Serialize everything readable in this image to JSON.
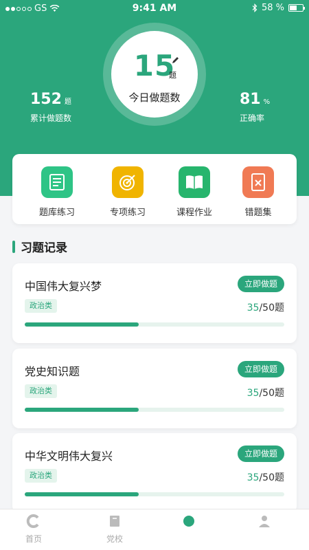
{
  "status_bar": {
    "carrier": "GS",
    "time": "9:41 AM",
    "battery_percent": "58 %",
    "battery_level": 0.58
  },
  "today": {
    "count": "15",
    "unit": "题",
    "label": "今日做题数"
  },
  "stats": {
    "total": {
      "value": "152",
      "unit": "题",
      "label": "累计做题数"
    },
    "accuracy": {
      "value": "81",
      "unit": "%",
      "label": "正确率"
    }
  },
  "quick_actions": [
    {
      "label": "题库练习",
      "icon": "question-bank-icon",
      "color": "#2ec486"
    },
    {
      "label": "专项练习",
      "icon": "target-icon",
      "color": "#f0b400"
    },
    {
      "label": "课程作业",
      "icon": "book-icon",
      "color": "#27b56d"
    },
    {
      "label": "错题集",
      "icon": "wrong-notebook-icon",
      "color": "#f07a54"
    }
  ],
  "section": {
    "title": "习题记录"
  },
  "records": [
    {
      "title": "中国伟大复兴梦",
      "tag": "政治类",
      "done": "35",
      "total": "/50题",
      "progress": 0.44,
      "button": "立即做题"
    },
    {
      "title": "党史知识题",
      "tag": "政治类",
      "done": "35",
      "total": "/50题",
      "progress": 0.44,
      "button": "立即做题"
    },
    {
      "title": "中华文明伟大复兴",
      "tag": "政治类",
      "done": "35",
      "total": "/50题",
      "progress": 0.44,
      "button": "立即做题"
    }
  ],
  "tabs": [
    {
      "label": "首页",
      "icon": "home-icon"
    },
    {
      "label": "党校",
      "icon": "school-icon"
    },
    {
      "label": "",
      "icon": "practice-icon"
    },
    {
      "label": "",
      "icon": "profile-icon"
    }
  ],
  "colors": {
    "primary": "#2ba67c",
    "tag_bg": "#e4f4ec"
  }
}
